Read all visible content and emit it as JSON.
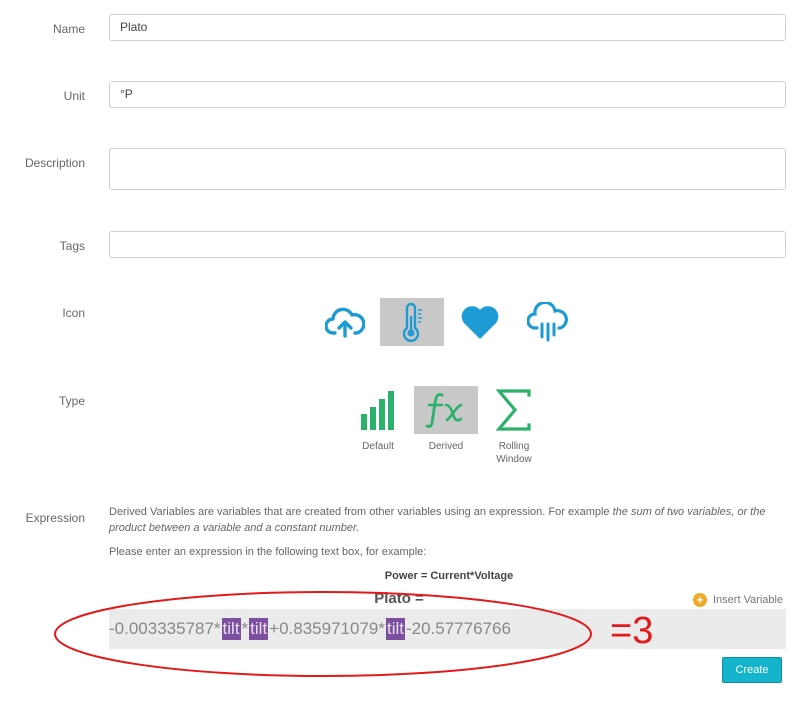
{
  "form": {
    "name": {
      "label": "Name",
      "value": "Plato"
    },
    "unit": {
      "label": "Unit",
      "value": "°P"
    },
    "description": {
      "label": "Description",
      "value": ""
    },
    "tags": {
      "label": "Tags",
      "value": ""
    },
    "icon": {
      "label": "Icon",
      "options": [
        "cloud-upload-icon",
        "thermometer-icon",
        "heart-icon",
        "cloud-rain-icon"
      ],
      "selected": "thermometer-icon"
    },
    "type": {
      "label": "Type",
      "options": [
        "Default",
        "Derived",
        "Rolling Window"
      ],
      "selected": "Derived"
    },
    "expression": {
      "label": "Expression",
      "intro_part1": "Derived Variables are variables that are created from other variables using an expression. For example ",
      "intro_example": "the sum of two variables, or the product between a variable and a constant number.",
      "prompt": "Please enter an expression in the following text box, for example:",
      "example": "Power = Current*Voltage",
      "result_title": "Plato =",
      "insert_variable": "Insert Variable",
      "expr_part1": "-0.003335787*",
      "token1": "tilt",
      "expr_part2": " *",
      "token2": "tilt",
      "expr_part3": " +0.835971079*",
      "token3": "tilt",
      "expr_part4": " -20.57776766"
    },
    "create_label": "Create"
  },
  "annotation": {
    "result": "=3",
    "color": "#e21a1a"
  },
  "colors": {
    "accent": "#1c9bd4",
    "green": "#2bb16a",
    "button": "#14b5cc",
    "token": "#7d4fa1"
  }
}
